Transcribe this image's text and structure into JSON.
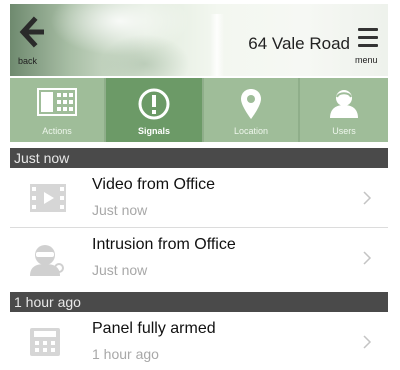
{
  "header": {
    "back_label": "back",
    "title": "64 Vale Road",
    "menu_label": "menu"
  },
  "tabs": [
    {
      "label": "Actions",
      "icon": "actions-icon",
      "active": false
    },
    {
      "label": "Signals",
      "icon": "signals-icon",
      "active": true
    },
    {
      "label": "Location",
      "icon": "location-pin-icon",
      "active": false
    },
    {
      "label": "Users",
      "icon": "users-icon",
      "active": false
    }
  ],
  "sections": [
    {
      "label": "Just now",
      "items": [
        {
          "title": "Video from Office",
          "time": "Just now",
          "icon": "video-icon"
        },
        {
          "title": "Intrusion from Office",
          "time": "Just now",
          "icon": "intruder-icon"
        }
      ]
    },
    {
      "label": "1 hour ago",
      "items": [
        {
          "title": "Panel fully armed",
          "time": "1 hour ago",
          "icon": "keypad-icon"
        }
      ]
    }
  ],
  "colors": {
    "tab_bg": "#9fbd99",
    "tab_active_bg": "#6c9a67",
    "section_bg": "#4a4a4a",
    "secondary_text": "#a8a8a8"
  }
}
